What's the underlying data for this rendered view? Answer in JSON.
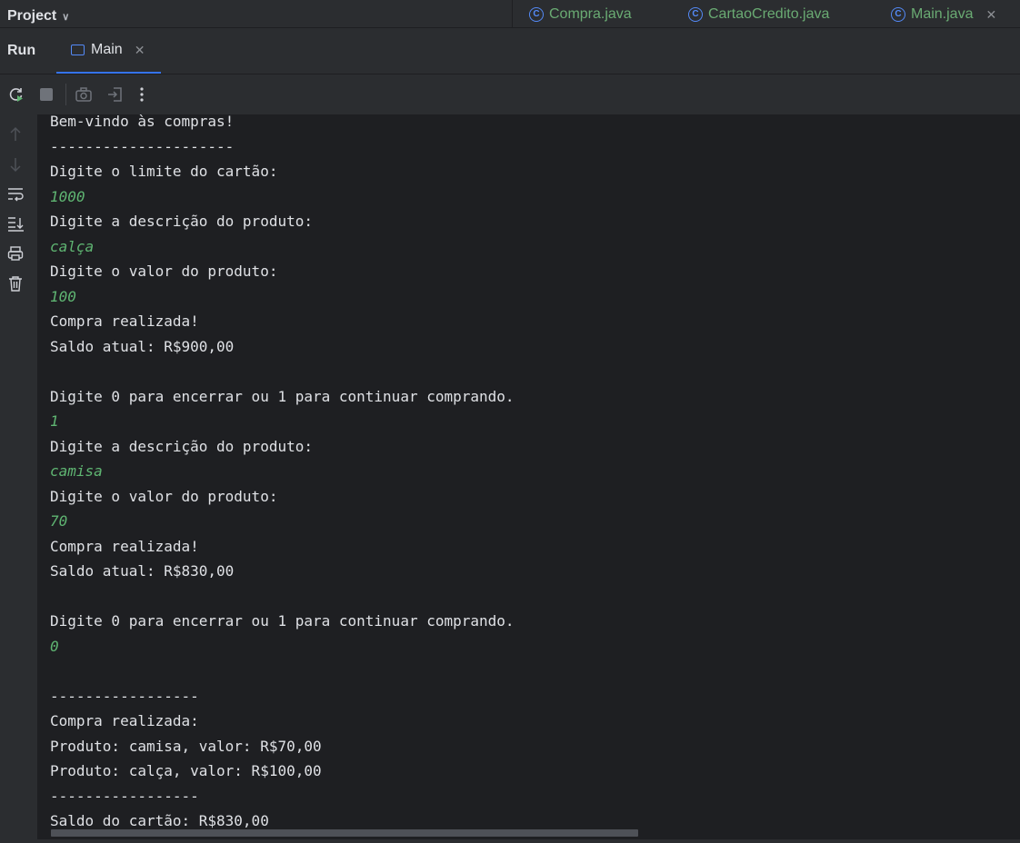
{
  "header": {
    "project_label": "Project",
    "editor_tabs": [
      {
        "label": "Compra.java",
        "icon": "class-icon"
      },
      {
        "label": "CartaoCredito.java",
        "icon": "class-icon"
      },
      {
        "label": "Main.java",
        "icon": "main-class-icon"
      }
    ]
  },
  "run_panel": {
    "title": "Run",
    "tab_label": "Main"
  },
  "toolbar": {
    "icons": [
      "rerun-icon",
      "stop-icon",
      "camera-icon",
      "exit-icon",
      "more-icon"
    ]
  },
  "gutter": {
    "icons": [
      "arrow-up-icon",
      "arrow-down-icon",
      "soft-wrap-icon",
      "scroll-to-end-icon",
      "print-icon",
      "trash-icon"
    ]
  },
  "console": {
    "lines": [
      {
        "text": "Bem-vindo às compras!",
        "input": false
      },
      {
        "text": "---------------------",
        "input": false
      },
      {
        "text": "Digite o limite do cartão:",
        "input": false
      },
      {
        "text": "1000",
        "input": true
      },
      {
        "text": "Digite a descrição do produto:",
        "input": false
      },
      {
        "text": "calça",
        "input": true
      },
      {
        "text": "Digite o valor do produto:",
        "input": false
      },
      {
        "text": "100",
        "input": true
      },
      {
        "text": "Compra realizada!",
        "input": false
      },
      {
        "text": "Saldo atual: R$900,00",
        "input": false
      },
      {
        "text": "",
        "input": false
      },
      {
        "text": "Digite 0 para encerrar ou 1 para continuar comprando.",
        "input": false
      },
      {
        "text": "1",
        "input": true
      },
      {
        "text": "Digite a descrição do produto:",
        "input": false
      },
      {
        "text": "camisa",
        "input": true
      },
      {
        "text": "Digite o valor do produto:",
        "input": false
      },
      {
        "text": "70",
        "input": true
      },
      {
        "text": "Compra realizada!",
        "input": false
      },
      {
        "text": "Saldo atual: R$830,00",
        "input": false
      },
      {
        "text": "",
        "input": false
      },
      {
        "text": "Digite 0 para encerrar ou 1 para continuar comprando.",
        "input": false
      },
      {
        "text": "0",
        "input": true
      },
      {
        "text": "",
        "input": false
      },
      {
        "text": "-----------------",
        "input": false
      },
      {
        "text": "Compra realizada:",
        "input": false
      },
      {
        "text": "Produto: camisa, valor: R$70,00",
        "input": false
      },
      {
        "text": "Produto: calça, valor: R$100,00",
        "input": false
      },
      {
        "text": "-----------------",
        "input": false
      },
      {
        "text": "Saldo do cartão: R$830,00",
        "input": false
      }
    ]
  },
  "colors": {
    "background": "#1e1f22",
    "panel": "#2b2d30",
    "text": "#dfe1e5",
    "user_input": "#5fb572",
    "tab_file": "#6aab73",
    "accent": "#3574f0"
  }
}
